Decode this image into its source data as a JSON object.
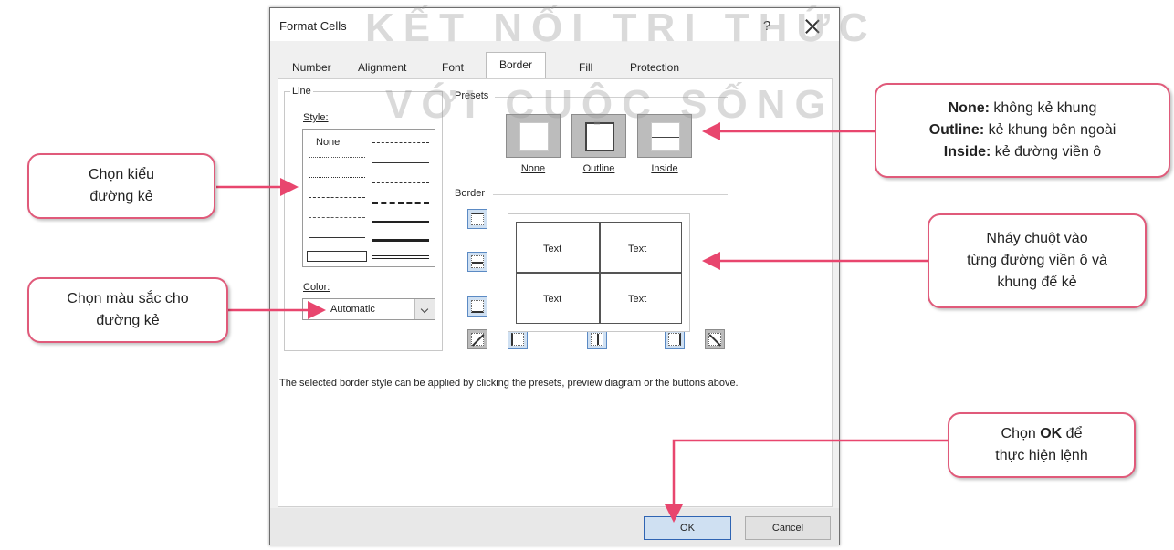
{
  "dialog": {
    "title": "Format Cells",
    "help": "?",
    "tabs": [
      "Number",
      "Alignment",
      "Font",
      "Border",
      "Fill",
      "Protection"
    ],
    "active_tab": "Border",
    "line_group": "Line",
    "style_label": "Style:",
    "style_none": "None",
    "color_label": "Color:",
    "color_value": "Automatic",
    "presets_label": "Presets",
    "presets": [
      "None",
      "Outline",
      "Inside"
    ],
    "border_label": "Border",
    "preview_text": [
      "Text",
      "Text",
      "Text",
      "Text"
    ],
    "hint": "The selected border style can be applied by clicking the presets, preview diagram or the buttons above.",
    "ok": "OK",
    "cancel": "Cancel"
  },
  "watermark": {
    "line1": "KẾT NỐI TRI THỨC",
    "line2": "VỚI CUỘC SỐNG"
  },
  "callouts": {
    "style": {
      "line1": "Chọn kiểu",
      "line2": "đường kẻ"
    },
    "color": {
      "line1": "Chọn màu sắc cho",
      "line2": "đường kẻ"
    },
    "presets": {
      "none_bold": "None:",
      "none_text": " không kẻ khung",
      "outline_bold": "Outline:",
      "outline_text": " kẻ khung bên ngoài",
      "inside_bold": "Inside:",
      "inside_text": " kẻ đường viền ô"
    },
    "border": {
      "line1": "Nháy chuột vào",
      "line2": "từng đường viền ô và",
      "line3": "khung để kẻ"
    },
    "ok": {
      "pre": "Chọn ",
      "bold": "OK",
      "post": " để",
      "line2": "thực hiện lệnh"
    }
  },
  "colors": {
    "callout_border": "#e05a7a",
    "arrow": "#e8466e",
    "ok_border": "#2f64b3"
  }
}
